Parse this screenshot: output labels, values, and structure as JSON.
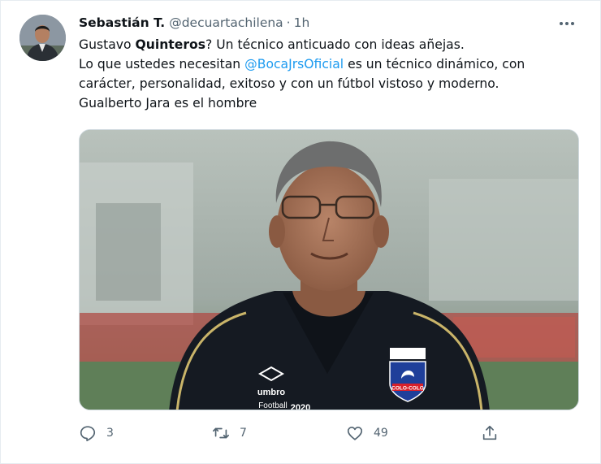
{
  "tweet": {
    "author": {
      "name": "Sebastián T.",
      "handle": "@decuartachilena",
      "separator": "·",
      "time": "1h"
    },
    "text": {
      "line1_a": "Gustavo ",
      "line1_bold": "Quinteros",
      "line1_b": "? Un técnico anticuado con ideas añejas.",
      "line2_a": "Lo que ustedes necesitan ",
      "line2_mention": "@BocaJrsOficial",
      "line2_b": " es un técnico dinámico, con",
      "line3": "carácter, personalidad, exitoso y con un fútbol vistoso y moderno.",
      "line4": "Gualberto Jara es el hombre"
    },
    "media": {
      "shirt_brand": "umbro",
      "sponsor": "Football",
      "sponsor_year": "2020",
      "crest_text": "COLO-COLO"
    },
    "actions": {
      "replies": "3",
      "retweets": "7",
      "likes": "49"
    }
  },
  "icons": {
    "more": "more-dots-icon",
    "reply": "reply-icon",
    "retweet": "retweet-icon",
    "like": "heart-icon",
    "share": "share-icon"
  },
  "colors": {
    "mention": "#1d9bf0",
    "secondary_text": "#536471",
    "shirt": "#151a22",
    "crest_blue": "#1f3f9a",
    "crest_red": "#d8202a"
  }
}
